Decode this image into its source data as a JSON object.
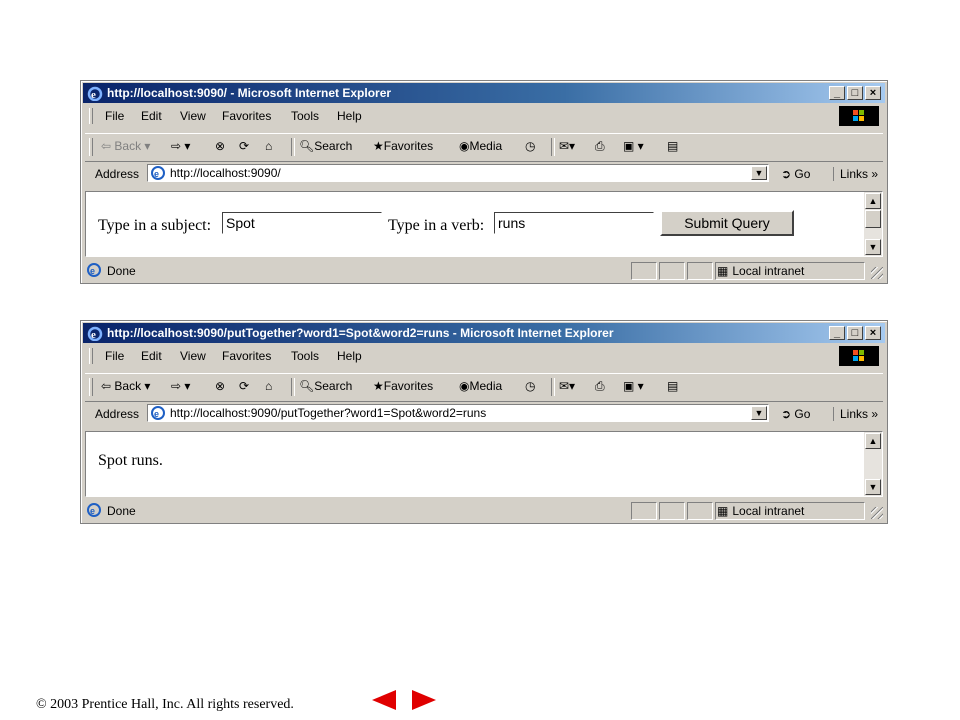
{
  "browser": {
    "menu": [
      "File",
      "Edit",
      "View",
      "Favorites",
      "Tools",
      "Help"
    ],
    "toolbar": {
      "back": "Back",
      "search": "Search",
      "favorites": "Favorites",
      "media": "Media"
    },
    "address_label": "Address",
    "go_label": "Go",
    "links_label": "Links",
    "links_chevron": "»",
    "status_done": "Done",
    "status_zone": "Local intranet"
  },
  "window1": {
    "title": "http://localhost:9090/ - Microsoft Internet Explorer",
    "url": "http://localhost:9090/",
    "form": {
      "subject_label": "Type in a subject:",
      "subject_value": "Spot",
      "verb_label": "Type in a verb:",
      "verb_value": "runs",
      "submit_label": "Submit Query"
    }
  },
  "window2": {
    "title": "http://localhost:9090/putTogether?word1=Spot&word2=runs - Microsoft Internet Explorer",
    "url": "http://localhost:9090/putTogether?word1=Spot&word2=runs",
    "result_text": "Spot runs."
  },
  "footer": {
    "copyright": "© 2003 Prentice Hall, Inc.  All rights reserved."
  },
  "colors": {
    "title_bar_start": "#0a246a",
    "title_bar_end": "#a6caf0",
    "nav_arrow": "#e00000",
    "chrome": "#d4d0c8"
  }
}
